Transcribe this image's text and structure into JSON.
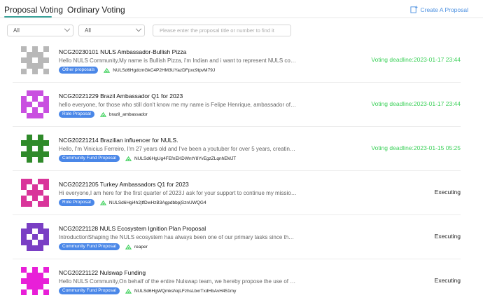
{
  "tabs": {
    "proposal_voting": "Proposal Voting",
    "ordinary_voting": "Ordinary Voting"
  },
  "create_button": "Create A Proposal",
  "filters": {
    "type": "All",
    "status": "All",
    "search_placeholder": "Please enter the proposal title or number to find it"
  },
  "colors": {
    "accent": "#3aa39a",
    "link": "#4a8fe0",
    "badge": "#4a87e8",
    "deadline": "#3ed15b"
  },
  "proposals": [
    {
      "title": "NCG20230101 NULS Ambassador-Bullish Pizza",
      "desc": "Hello NULS Community,My name is Bullish Pizza, i'm Indian and i want to represent NULS council ...",
      "badge": "Other proposals",
      "author": "NULSd6HgdcmGkC4P2HM3UYazDFpxc9tpvM79J",
      "status": "Voting deadline:2023-01-17 23:44",
      "avatar_color": "#b8b8b8"
    },
    {
      "title": "NCG20221229 Brazil Ambassador Q1 for 2023",
      "desc": "hello everyone, for those who still don't know me my name is Felipe Henrique, ambassador of nul...",
      "badge": "Role Proposal",
      "author": "brazil_ambassador",
      "status": "Voting deadline:2023-01-17 23:44",
      "avatar_color": "#c94fe0"
    },
    {
      "title": "NCG20221214 Brazilian influencer for NULS.",
      "desc": "Hello, I'm Vinicius Ferreiro, I'm 27 years old and I've been a youtuber for over 5 years, creating c...",
      "badge": "Community Fund Proposal",
      "author": "NULSd6HgUg4FEfnEKDWntY8YvEgzZLqnhEMJT",
      "status": "Voting deadline:2023-01-15 05:25",
      "avatar_color": "#2f8a2a"
    },
    {
      "title": "NCG20221205 Turkey Ambassadors Q1 for 2023",
      "desc": "Hi everyone,I am here for the first quarter of 2023.I ask for your support to continue my mission ...",
      "badge": "Role Proposal",
      "author": "NULSd6Hgi4h2jtfDwHzB3AgpdbbpjSznUWQG4",
      "status": "Executing",
      "avatar_color": "#d9359a"
    },
    {
      "title": "NCG20221128 NULS Ecosystem Ignition Plan Proposal",
      "desc": "IntroductionShaping the NULS ecosystem has always been one of our primary tasks since the lau...",
      "badge": "Community Fund Proposal",
      "author": "reaper",
      "status": "Executing",
      "avatar_color": "#7a3fc4"
    },
    {
      "title": "NCG20221122 Nulswap Funding",
      "desc": "Hello NULS Community,On behalf of the entire Nulswap team, we hereby propose the use of comm...",
      "badge": "Community Fund Proposal",
      "author": "NULSd6HgWQmksNqLFzhsLbxrTxdHbAvH451my",
      "status": "Executing",
      "avatar_color": "#e81fd8"
    }
  ]
}
